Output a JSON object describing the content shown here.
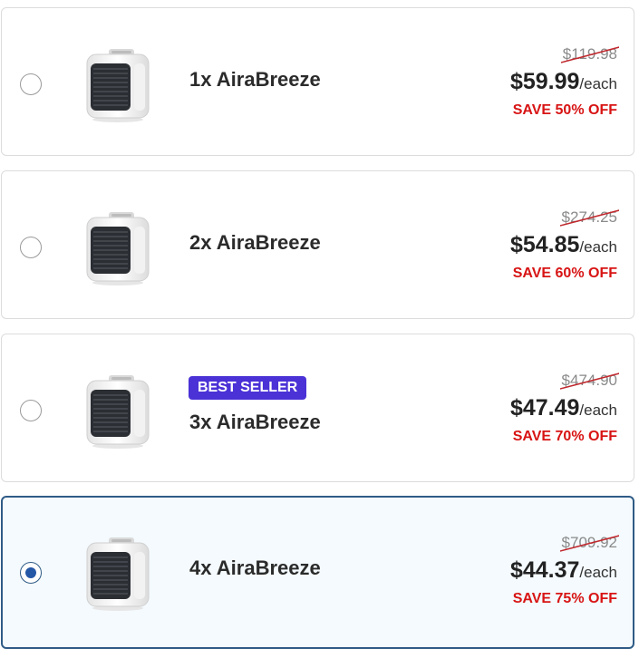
{
  "colors": {
    "save_red": "#d81414",
    "badge_purple": "#4a32d6",
    "selected_border": "#2f5b86",
    "selected_bg": "#f4fafd",
    "radio_dot": "#2557a7"
  },
  "options": [
    {
      "name": "1x AiraBreeze",
      "original_price": "$119.98",
      "price": "$59.99",
      "per": "/each",
      "save": "SAVE 50% OFF",
      "badge": "",
      "selected": false,
      "image": "portable-air-cooler"
    },
    {
      "name": "2x AiraBreeze",
      "original_price": "$274.25",
      "price": "$54.85",
      "per": "/each",
      "save": "SAVE 60% OFF",
      "badge": "",
      "selected": false,
      "image": "portable-air-cooler"
    },
    {
      "name": "3x AiraBreeze",
      "original_price": "$474.90",
      "price": "$47.49",
      "per": "/each",
      "save": "SAVE 70% OFF",
      "badge": "BEST SELLER",
      "selected": false,
      "image": "portable-air-cooler"
    },
    {
      "name": "4x AiraBreeze",
      "original_price": "$709.92",
      "price": "$44.37",
      "per": "/each",
      "save": "SAVE 75% OFF",
      "badge": "",
      "selected": true,
      "image": "portable-air-cooler"
    }
  ]
}
